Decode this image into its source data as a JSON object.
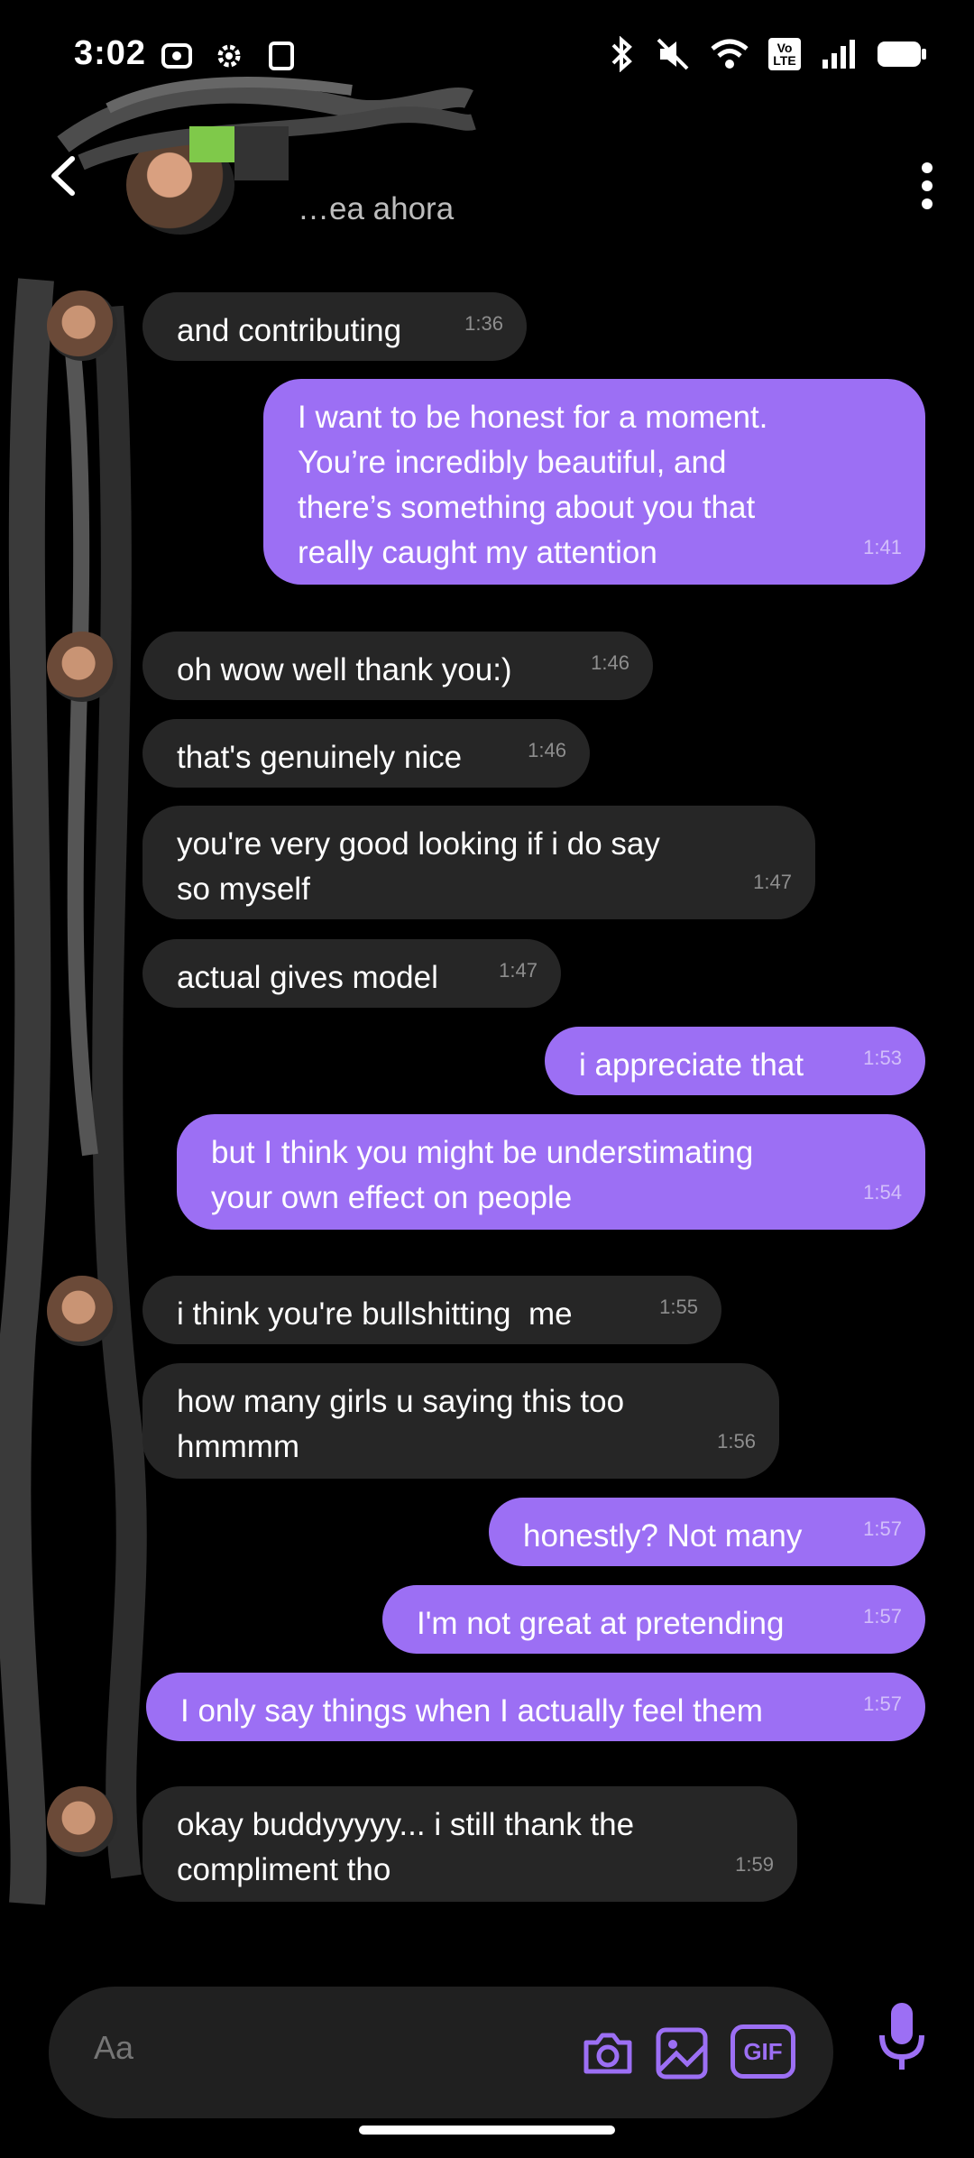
{
  "status_bar": {
    "time": "3:02",
    "network_badge": "Vo LTE"
  },
  "header": {
    "contact_status": "…ea ahora"
  },
  "messages": [
    {
      "dir": "in",
      "text": "and contributing",
      "time": "1:36"
    },
    {
      "dir": "out",
      "text": "I want to be honest for a moment.\nYou’re incredibly beautiful, and\nthere’s something about you that\nreally caught my attention",
      "time": "1:41"
    },
    {
      "dir": "in",
      "text": "oh wow well thank you:)",
      "time": "1:46"
    },
    {
      "dir": "in",
      "text": "that's genuinely nice",
      "time": "1:46"
    },
    {
      "dir": "in",
      "text": "you're very good looking if i do say\nso myself",
      "time": "1:47"
    },
    {
      "dir": "in",
      "text": "actual gives model",
      "time": "1:47"
    },
    {
      "dir": "out",
      "text": "i appreciate that",
      "time": "1:53"
    },
    {
      "dir": "out",
      "text": "but I think you might be understimating\nyour own effect on people",
      "time": "1:54"
    },
    {
      "dir": "in",
      "text": "i think you're bullshitting  me",
      "time": "1:55"
    },
    {
      "dir": "in",
      "text": "how many girls u saying this too\nhmmmm",
      "time": "1:56"
    },
    {
      "dir": "out",
      "text": "honestly? Not many",
      "time": "1:57"
    },
    {
      "dir": "out",
      "text": "I'm not great at pretending",
      "time": "1:57"
    },
    {
      "dir": "out",
      "text": "I only say things when I actually feel them",
      "time": "1:57"
    },
    {
      "dir": "in",
      "text": "okay buddyyyyy... i still thank the\ncompliment tho",
      "time": "1:59"
    }
  ],
  "composer": {
    "placeholder": "Aa",
    "gif_label": "GIF"
  },
  "colors": {
    "outgoing_bubble": "#9c6ff4",
    "incoming_bubble": "#262626",
    "accent": "#9c6ff4",
    "background": "#000000"
  }
}
